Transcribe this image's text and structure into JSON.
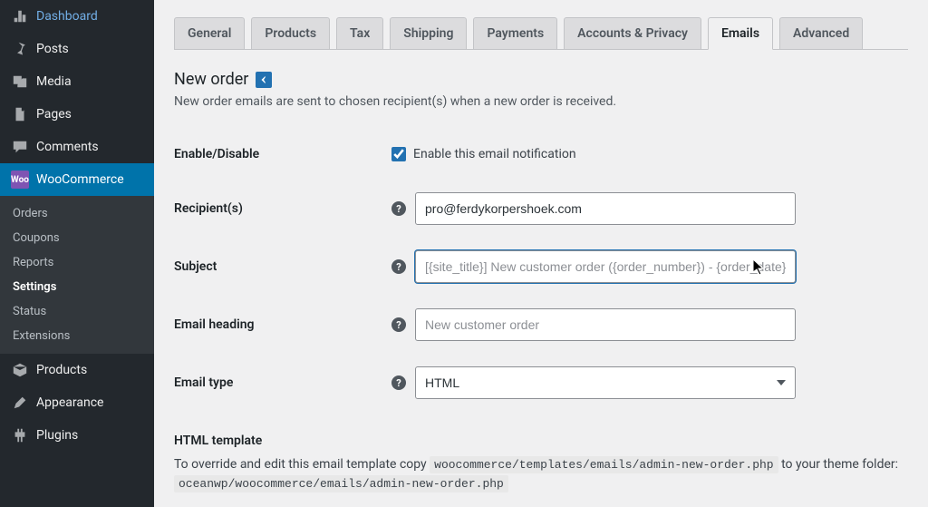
{
  "sidebar": {
    "items": [
      {
        "label": "Dashboard",
        "icon": "dashboard"
      },
      {
        "label": "Posts",
        "icon": "pin"
      },
      {
        "label": "Media",
        "icon": "media"
      },
      {
        "label": "Pages",
        "icon": "pages"
      },
      {
        "label": "Comments",
        "icon": "comments"
      },
      {
        "label": "WooCommerce",
        "icon": "woo",
        "active": true
      },
      {
        "label": "Products",
        "icon": "products"
      },
      {
        "label": "Appearance",
        "icon": "appearance"
      },
      {
        "label": "Plugins",
        "icon": "plugins"
      }
    ],
    "submenu": [
      {
        "label": "Orders"
      },
      {
        "label": "Coupons"
      },
      {
        "label": "Reports"
      },
      {
        "label": "Settings",
        "current": true
      },
      {
        "label": "Status"
      },
      {
        "label": "Extensions"
      }
    ]
  },
  "tabs": [
    {
      "label": "General"
    },
    {
      "label": "Products"
    },
    {
      "label": "Tax"
    },
    {
      "label": "Shipping"
    },
    {
      "label": "Payments"
    },
    {
      "label": "Accounts & Privacy"
    },
    {
      "label": "Emails",
      "active": true
    },
    {
      "label": "Advanced"
    }
  ],
  "page": {
    "title": "New order",
    "description": "New order emails are sent to chosen recipient(s) when a new order is received."
  },
  "form": {
    "enable": {
      "label": "Enable/Disable",
      "checkbox_label": "Enable this email notification",
      "checked": true
    },
    "recipient": {
      "label": "Recipient(s)",
      "value": "pro@ferdykorpershoek.com"
    },
    "subject": {
      "label": "Subject",
      "placeholder": "[{site_title}] New customer order ({order_number}) - {order_date}"
    },
    "heading": {
      "label": "Email heading",
      "placeholder": "New customer order"
    },
    "email_type": {
      "label": "Email type",
      "value": "HTML",
      "options": [
        "HTML"
      ]
    },
    "html_template": {
      "label": "HTML template"
    },
    "override": {
      "before": "To override and edit this email template copy ",
      "code1": "woocommerce/templates/emails/admin-new-order.php",
      "mid": " to your theme folder: ",
      "code2": "oceanwp/woocommerce/emails/admin-new-order.php"
    }
  }
}
